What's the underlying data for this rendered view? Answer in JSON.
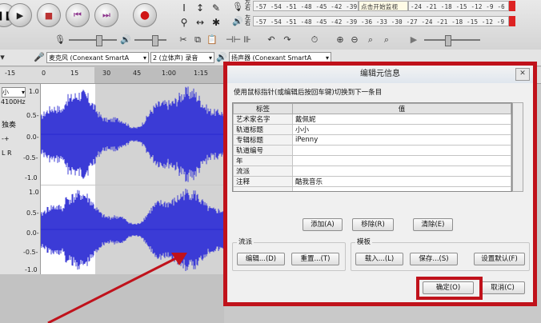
{
  "toolbar": {
    "play_icon": "play-icon",
    "stop_icon": "stop-icon",
    "skip_start_icon": "skip-start-icon",
    "skip_end_icon": "skip-end-icon",
    "record_icon": "record-icon",
    "meter_top": "-57 -54 -51 -48 -45 -42 -39 -",
    "meter_top_hint": "点击开始监视",
    "meter_top_right": "-24 -21 -18 -15 -12 -9 -6 -3 0",
    "meter_bottom": "-57 -54 -51 -48 -45 -42 -39 -36 -33 -30 -27 -24 -21 -18 -15 -12 -9 -6 -3 0",
    "lr_top_l": "左",
    "lr_top_r": "右",
    "lr_bottom_l": "左",
    "lr_bottom_r": "右"
  },
  "devices": {
    "mic_label": "麦克风 (Conexant SmartA",
    "channels_label": "2 (立体声) 录音",
    "speaker_label": "扬声器 (Conexant SmartA"
  },
  "ruler": {
    "ticks": [
      "-15",
      "0",
      "15",
      "30",
      "45",
      "1:00",
      "1:15"
    ]
  },
  "tracks": {
    "t1_name": "小",
    "t1_rate": "4100Hz",
    "t1_mute": "独奏",
    "scale_top": [
      "1.0",
      "0.5-",
      "0.0-",
      "-0.5-",
      "-1.0"
    ],
    "scale_bottom": [
      "1.0",
      "0.5-",
      "0.0-",
      "-0.5-",
      "-1.0"
    ]
  },
  "dialog": {
    "title": "编辑元信息",
    "instruction": "使用鼠标指针(或编辑后按回车键)切换到下一条目",
    "col_tag": "标签",
    "col_value": "值",
    "rows": [
      {
        "tag": "艺术家名字",
        "value": "戴佩妮"
      },
      {
        "tag": "轨道标题",
        "value": "小小"
      },
      {
        "tag": "专辑标题",
        "value": "iPenny"
      },
      {
        "tag": "轨道编号",
        "value": ""
      },
      {
        "tag": "年",
        "value": ""
      },
      {
        "tag": "流派",
        "value": ""
      },
      {
        "tag": "注释",
        "value": "酷我音乐"
      },
      {
        "tag": "",
        "value": ""
      },
      {
        "tag": "",
        "value": ""
      }
    ],
    "add_button": "添加(A)",
    "remove_button": "移除(R)",
    "clear_button": "清除(E)",
    "genre_group": "流派",
    "edit_button": "编辑...(D)",
    "reset_button": "重置...(T)",
    "template_group": "模板",
    "load_button": "载入...(L)",
    "save_button": "保存...(S)",
    "default_button": "设置默认(F)",
    "ok_button": "确定(O)",
    "cancel_button": "取消(C)"
  }
}
